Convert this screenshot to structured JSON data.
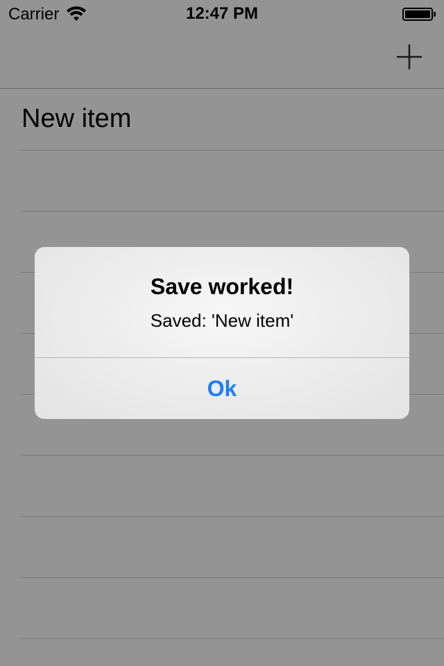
{
  "status_bar": {
    "carrier": "Carrier",
    "time": "12:47 PM",
    "wifi_icon": "wifi-icon",
    "battery_icon": "battery-full-icon"
  },
  "nav_bar": {
    "add_icon": "plus-icon"
  },
  "list": {
    "items": [
      {
        "label": "New item"
      },
      {
        "label": ""
      },
      {
        "label": ""
      },
      {
        "label": ""
      },
      {
        "label": ""
      },
      {
        "label": ""
      },
      {
        "label": ""
      },
      {
        "label": ""
      },
      {
        "label": ""
      }
    ]
  },
  "alert": {
    "title": "Save worked!",
    "message": "Saved: 'New item'",
    "button_label": "Ok"
  },
  "colors": {
    "accent": "#1a7ff6",
    "separator": "#c8c7cc",
    "overlay": "rgba(0,0,0,0.4)"
  }
}
